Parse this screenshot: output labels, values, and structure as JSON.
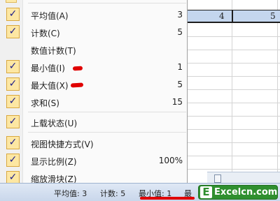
{
  "spreadsheet": {
    "cells": [
      "4",
      "5"
    ]
  },
  "menu": {
    "items": [
      {
        "label": "平均值(A)",
        "value": "3",
        "checked": true
      },
      {
        "label": "计数(C)",
        "value": "5",
        "checked": true
      },
      {
        "label": "数值计数(T)",
        "value": "",
        "checked": false
      },
      {
        "label": "最小值(I)",
        "value": "1",
        "checked": true
      },
      {
        "label": "最大值(X)",
        "value": "5",
        "checked": true
      },
      {
        "label": "求和(S)",
        "value": "15",
        "checked": true
      },
      {
        "label": "上载状态(U)",
        "value": "",
        "checked": true
      },
      {
        "label": "视图快捷方式(V)",
        "value": "",
        "checked": true
      },
      {
        "label": "显示比例(Z)",
        "value": "100%",
        "checked": true
      },
      {
        "label": "缩放滑块(Z)",
        "value": "",
        "checked": true
      }
    ],
    "check_glyph": "✓"
  },
  "statusbar": {
    "average": "平均值: 3",
    "count": "计数: 5",
    "min": "最小值: 1",
    "max_partial": "最"
  },
  "watermark": {
    "logo_letter": "E",
    "logo_text": "Excelcn.com"
  },
  "colors": {
    "highlight_red": "#e00000",
    "check_bg": "#fde7a3",
    "check_border": "#d9a83f",
    "logo_green": "#2f8f2f"
  }
}
